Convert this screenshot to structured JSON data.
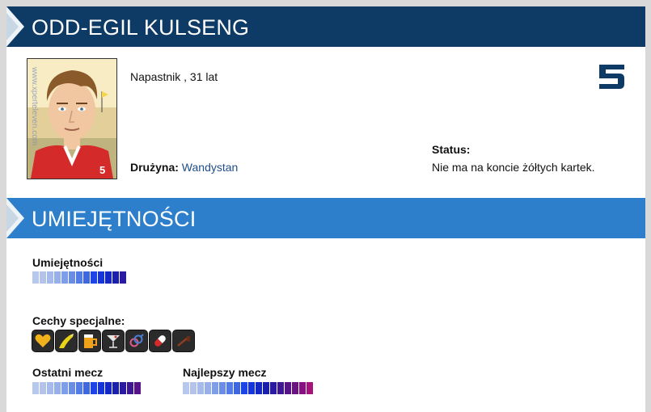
{
  "player": {
    "name": "ODD-EGIL KULSENG",
    "role_age": "Napastnik , 31 lat",
    "team_label": "Drużyna:",
    "team_name": "Wandystan",
    "status_label": "Status:",
    "status_value": "Nie ma na koncie żółtych kartek.",
    "shirt_number": "5",
    "photo_watermark": "www.xperteleven.com"
  },
  "skills_section": {
    "title": "UMIEJĘTNOŚCI",
    "skill_label": "Umiejętności",
    "skill_level": 13,
    "specials_label": "Cechy specjalne:",
    "specials": [
      "heart-icon",
      "boot-icon",
      "beer-icon",
      "cocktail-icon",
      "gender-icon",
      "pill-icon",
      "pipe-icon"
    ],
    "last_match_label": "Ostatni mecz",
    "last_match_level": 15,
    "best_match_label": "Najlepszy mecz",
    "best_match_level": 18
  },
  "colors": {
    "header_dark": "#0d3b66",
    "header_light": "#2e7fcb",
    "scale": [
      "#b8c8ec",
      "#b3c3ea",
      "#a7bbea",
      "#98b0ea",
      "#7f9ee8",
      "#6a8de8",
      "#557ce6",
      "#3e67e4",
      "#1f44e6",
      "#1435e0",
      "#1528c4",
      "#1a1fb0",
      "#2a1ba0",
      "#3d1796",
      "#561488",
      "#6d1282",
      "#861180",
      "#a8137b"
    ]
  }
}
